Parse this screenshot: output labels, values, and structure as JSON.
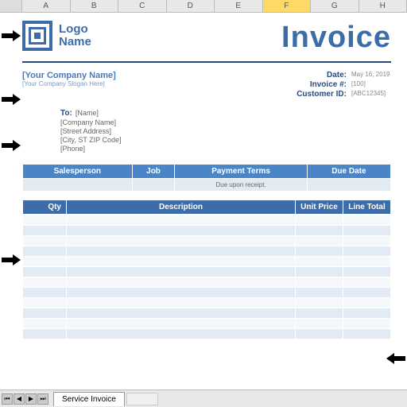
{
  "columns": [
    "A",
    "B",
    "C",
    "D",
    "E",
    "F",
    "G",
    "H"
  ],
  "selected_col": "F",
  "logo": {
    "line1": "Logo",
    "line2": "Name"
  },
  "title": "Invoice",
  "company": {
    "name": "[Your Company Name]",
    "slogan": "[Your Company Slogan Here]"
  },
  "meta": {
    "date_label": "Date:",
    "date_val": "May 16, 2019",
    "inv_label": "Invoice #:",
    "inv_val": "[100]",
    "cust_label": "Customer ID:",
    "cust_val": "[ABC12345]"
  },
  "to": {
    "label": "To:",
    "name": "[Name]",
    "company": "[Company Name]",
    "street": "[Street Address]",
    "city": "[City, ST ZIP Code]",
    "phone": "[Phone]"
  },
  "summary": {
    "headers": [
      "Salesperson",
      "Job",
      "Payment Terms",
      "Due Date"
    ],
    "row": [
      "",
      "",
      "Due upon receipt.",
      ""
    ]
  },
  "detail_headers": {
    "qty": "Qty",
    "desc": "Description",
    "unit": "Unit Price",
    "total": "Line Total"
  },
  "tab_name": "Service Invoice"
}
